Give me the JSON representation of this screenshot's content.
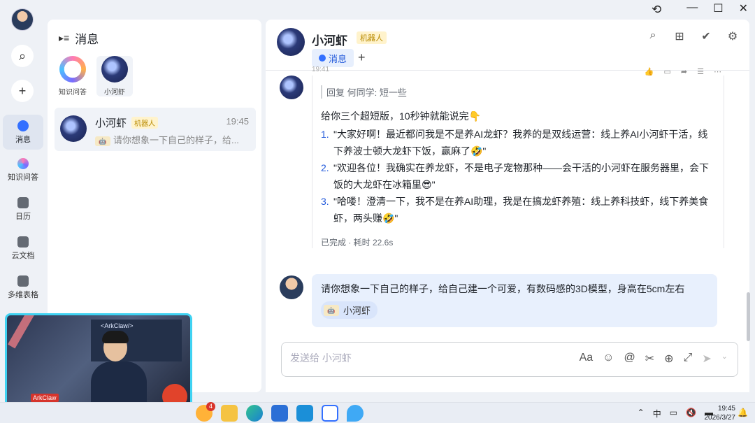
{
  "window": {
    "history_icon": "history-icon",
    "controls": [
      "—",
      "☐",
      "✕"
    ]
  },
  "rail": {
    "items": [
      {
        "label": "消息",
        "icon": "message-icon",
        "color": "#3370ff"
      },
      {
        "label": "知识问答",
        "icon": "knowledge-icon",
        "color": "#c05cff"
      },
      {
        "label": "日历",
        "icon": "calendar-icon",
        "color": "#646a73"
      },
      {
        "label": "云文档",
        "icon": "doc-icon",
        "color": "#646a73"
      },
      {
        "label": "多维表格",
        "icon": "table-icon",
        "color": "#646a73"
      }
    ],
    "search_icon": "⌕",
    "add_icon": "+"
  },
  "list": {
    "title": "消息",
    "pinned": [
      {
        "label": "知识问答"
      },
      {
        "label": "小河虾"
      }
    ],
    "conversation": {
      "name": "小河虾",
      "tag": "机器人",
      "time": "19:45",
      "preview": "请你想象一下自己的样子，给..."
    }
  },
  "chat": {
    "title": "小河虾",
    "robot_tag": "机器人",
    "tab_label": "消息",
    "add_tab": "+",
    "faded_time": "19:41",
    "bot_message": {
      "reply_quote": "回复 何同学: 短一些",
      "intro": "给你三个超短版，10秒钟就能说完👇",
      "items": [
        {
          "num": "1.",
          "text": "\"大家好啊！最近都问我是不是养AI龙虾？我养的是双线运营：线上养AI小河虾干活，线下养波士顿大龙虾下饭，赢麻了🤣\""
        },
        {
          "num": "2.",
          "text": "\"欢迎各位！我确实在养龙虾，不是电子宠物那种——会干活的小河虾在服务器里，会下饭的大龙虾在冰箱里😎\""
        },
        {
          "num": "3.",
          "text": "\"哈喽！澄清一下，我不是在养AI助理，我是在搞龙虾养殖：线上养科技虾，线下养美食虾，两头赚🤣\""
        }
      ],
      "status": "已完成 · 耗时 22.6s"
    },
    "my_message": {
      "text": "请你想象一下自己的样子，给自己建一个可爱，有数码感的3D模型，身高在5cm左右",
      "chip": "小河虾"
    },
    "input": {
      "placeholder": "发送给 小河虾"
    }
  },
  "camera": {
    "board_text": "<ArkClaw/>",
    "logo_text": "ArkClaw"
  },
  "taskbar": {
    "badge_count": "4",
    "tray_lang": "中",
    "clock_time": "19:45",
    "clock_date": "2026/3/27"
  }
}
